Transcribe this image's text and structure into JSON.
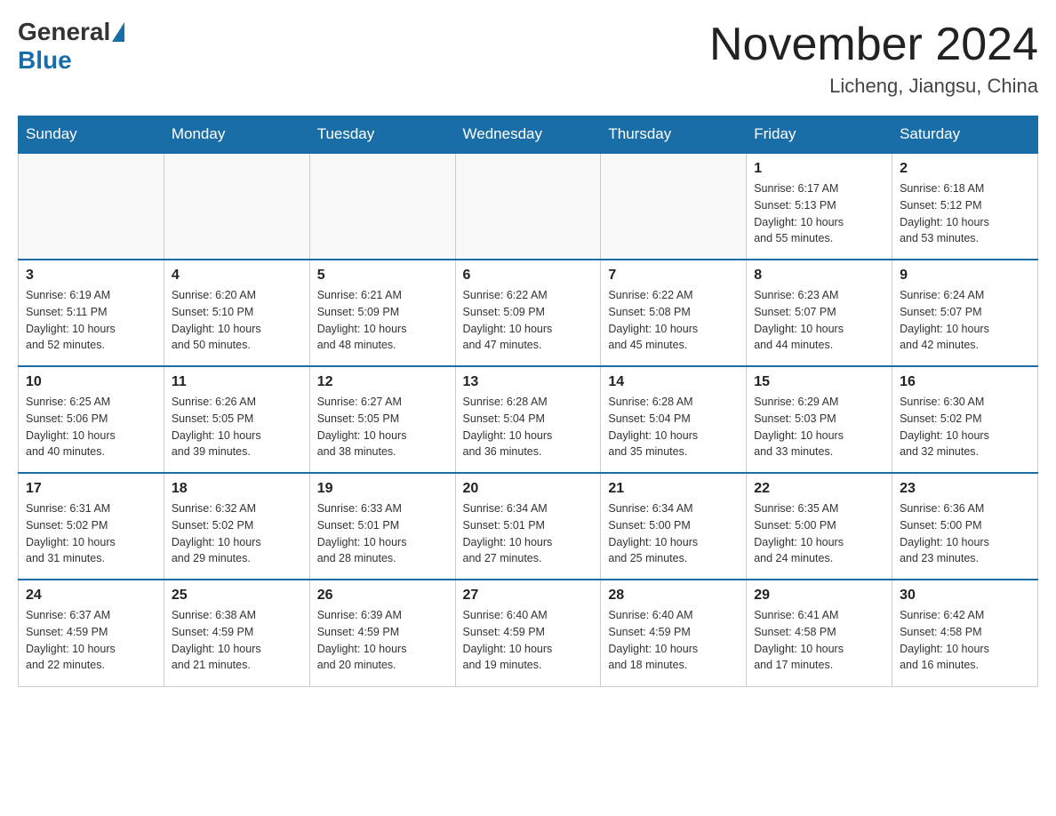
{
  "header": {
    "logo_general": "General",
    "logo_blue": "Blue",
    "month_title": "November 2024",
    "location": "Licheng, Jiangsu, China"
  },
  "days_of_week": [
    "Sunday",
    "Monday",
    "Tuesday",
    "Wednesday",
    "Thursday",
    "Friday",
    "Saturday"
  ],
  "weeks": [
    [
      {
        "day": "",
        "info": ""
      },
      {
        "day": "",
        "info": ""
      },
      {
        "day": "",
        "info": ""
      },
      {
        "day": "",
        "info": ""
      },
      {
        "day": "",
        "info": ""
      },
      {
        "day": "1",
        "info": "Sunrise: 6:17 AM\nSunset: 5:13 PM\nDaylight: 10 hours\nand 55 minutes."
      },
      {
        "day": "2",
        "info": "Sunrise: 6:18 AM\nSunset: 5:12 PM\nDaylight: 10 hours\nand 53 minutes."
      }
    ],
    [
      {
        "day": "3",
        "info": "Sunrise: 6:19 AM\nSunset: 5:11 PM\nDaylight: 10 hours\nand 52 minutes."
      },
      {
        "day": "4",
        "info": "Sunrise: 6:20 AM\nSunset: 5:10 PM\nDaylight: 10 hours\nand 50 minutes."
      },
      {
        "day": "5",
        "info": "Sunrise: 6:21 AM\nSunset: 5:09 PM\nDaylight: 10 hours\nand 48 minutes."
      },
      {
        "day": "6",
        "info": "Sunrise: 6:22 AM\nSunset: 5:09 PM\nDaylight: 10 hours\nand 47 minutes."
      },
      {
        "day": "7",
        "info": "Sunrise: 6:22 AM\nSunset: 5:08 PM\nDaylight: 10 hours\nand 45 minutes."
      },
      {
        "day": "8",
        "info": "Sunrise: 6:23 AM\nSunset: 5:07 PM\nDaylight: 10 hours\nand 44 minutes."
      },
      {
        "day": "9",
        "info": "Sunrise: 6:24 AM\nSunset: 5:07 PM\nDaylight: 10 hours\nand 42 minutes."
      }
    ],
    [
      {
        "day": "10",
        "info": "Sunrise: 6:25 AM\nSunset: 5:06 PM\nDaylight: 10 hours\nand 40 minutes."
      },
      {
        "day": "11",
        "info": "Sunrise: 6:26 AM\nSunset: 5:05 PM\nDaylight: 10 hours\nand 39 minutes."
      },
      {
        "day": "12",
        "info": "Sunrise: 6:27 AM\nSunset: 5:05 PM\nDaylight: 10 hours\nand 38 minutes."
      },
      {
        "day": "13",
        "info": "Sunrise: 6:28 AM\nSunset: 5:04 PM\nDaylight: 10 hours\nand 36 minutes."
      },
      {
        "day": "14",
        "info": "Sunrise: 6:28 AM\nSunset: 5:04 PM\nDaylight: 10 hours\nand 35 minutes."
      },
      {
        "day": "15",
        "info": "Sunrise: 6:29 AM\nSunset: 5:03 PM\nDaylight: 10 hours\nand 33 minutes."
      },
      {
        "day": "16",
        "info": "Sunrise: 6:30 AM\nSunset: 5:02 PM\nDaylight: 10 hours\nand 32 minutes."
      }
    ],
    [
      {
        "day": "17",
        "info": "Sunrise: 6:31 AM\nSunset: 5:02 PM\nDaylight: 10 hours\nand 31 minutes."
      },
      {
        "day": "18",
        "info": "Sunrise: 6:32 AM\nSunset: 5:02 PM\nDaylight: 10 hours\nand 29 minutes."
      },
      {
        "day": "19",
        "info": "Sunrise: 6:33 AM\nSunset: 5:01 PM\nDaylight: 10 hours\nand 28 minutes."
      },
      {
        "day": "20",
        "info": "Sunrise: 6:34 AM\nSunset: 5:01 PM\nDaylight: 10 hours\nand 27 minutes."
      },
      {
        "day": "21",
        "info": "Sunrise: 6:34 AM\nSunset: 5:00 PM\nDaylight: 10 hours\nand 25 minutes."
      },
      {
        "day": "22",
        "info": "Sunrise: 6:35 AM\nSunset: 5:00 PM\nDaylight: 10 hours\nand 24 minutes."
      },
      {
        "day": "23",
        "info": "Sunrise: 6:36 AM\nSunset: 5:00 PM\nDaylight: 10 hours\nand 23 minutes."
      }
    ],
    [
      {
        "day": "24",
        "info": "Sunrise: 6:37 AM\nSunset: 4:59 PM\nDaylight: 10 hours\nand 22 minutes."
      },
      {
        "day": "25",
        "info": "Sunrise: 6:38 AM\nSunset: 4:59 PM\nDaylight: 10 hours\nand 21 minutes."
      },
      {
        "day": "26",
        "info": "Sunrise: 6:39 AM\nSunset: 4:59 PM\nDaylight: 10 hours\nand 20 minutes."
      },
      {
        "day": "27",
        "info": "Sunrise: 6:40 AM\nSunset: 4:59 PM\nDaylight: 10 hours\nand 19 minutes."
      },
      {
        "day": "28",
        "info": "Sunrise: 6:40 AM\nSunset: 4:59 PM\nDaylight: 10 hours\nand 18 minutes."
      },
      {
        "day": "29",
        "info": "Sunrise: 6:41 AM\nSunset: 4:58 PM\nDaylight: 10 hours\nand 17 minutes."
      },
      {
        "day": "30",
        "info": "Sunrise: 6:42 AM\nSunset: 4:58 PM\nDaylight: 10 hours\nand 16 minutes."
      }
    ]
  ]
}
